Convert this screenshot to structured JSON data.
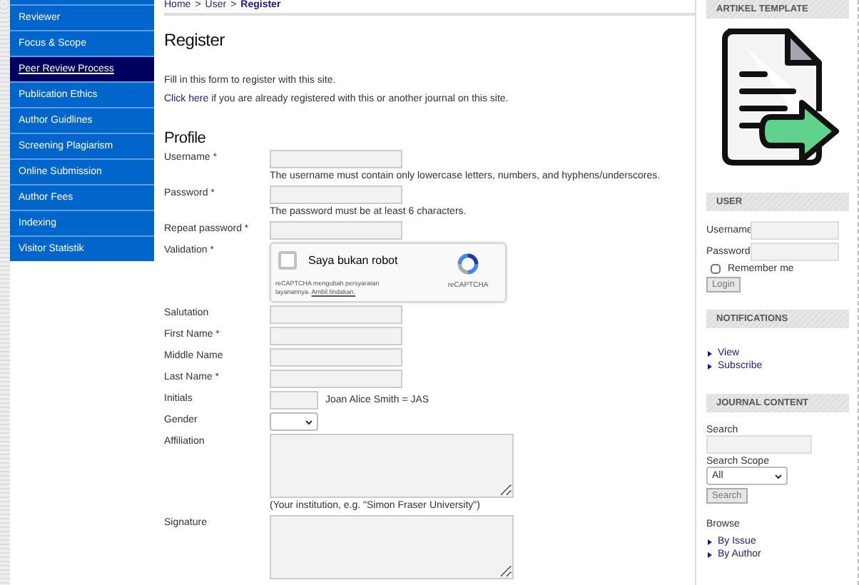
{
  "breadcrumb": {
    "items": [
      {
        "label": "Home",
        "selected": false
      },
      {
        "label": "User",
        "selected": false
      },
      {
        "label": "Register",
        "selected": true
      }
    ],
    "separator": ">"
  },
  "nav": {
    "items": [
      {
        "label": "Reviewer",
        "selected": false
      },
      {
        "label": "Focus & Scope",
        "selected": false
      },
      {
        "label": "Peer Review Process",
        "selected": true
      },
      {
        "label": "Publication Ethics",
        "selected": false
      },
      {
        "label": "Author Guidlines",
        "selected": false
      },
      {
        "label": "Screening Plagiarism",
        "selected": false
      },
      {
        "label": "Online Submission",
        "selected": false
      },
      {
        "label": "Author Fees",
        "selected": false
      },
      {
        "label": "Indexing",
        "selected": false
      },
      {
        "label": "Visitor Statistik",
        "selected": false
      }
    ]
  },
  "main": {
    "title": "Register",
    "intro": "Fill in this form to register with this site.",
    "login_link": "Click here",
    "login_text": "if you are already registered with this or another journal on this site.",
    "section_title": "Profile",
    "fields": [
      {
        "kind": "text",
        "label": "Username *",
        "hint": "The username must contain only lowercase letters, numbers, and hyphens/underscores."
      },
      {
        "kind": "password",
        "label": "Password *",
        "hint": "The password must be at least 6 characters."
      },
      {
        "kind": "password",
        "label": "Repeat password *"
      },
      {
        "kind": "captcha",
        "label": "Validation *",
        "checkbox_label": "Saya bukan robot",
        "checked": false,
        "brand": "reCAPTCHA",
        "notice": "reCAPTCHA mengubah persyaratan layanannya.",
        "notice_link": "Ambil tindakan."
      },
      {
        "kind": "text",
        "label": "Salutation"
      },
      {
        "kind": "text",
        "label": "First Name *"
      },
      {
        "kind": "text",
        "label": "Middle Name"
      },
      {
        "kind": "text",
        "label": "Last Name *"
      },
      {
        "kind": "short",
        "label": "Initials",
        "note": "Joan Alice Smith = JAS"
      },
      {
        "kind": "select",
        "label": "Gender"
      },
      {
        "kind": "textarea",
        "label": "Affiliation",
        "hint": "(Your institution, e.g. \"Simon Fraser University\")"
      },
      {
        "kind": "textarea",
        "label": "Signature"
      }
    ]
  },
  "sidebar": {
    "blocks": [
      {
        "kind": "image",
        "title": "ARTIKEL TEMPLATE"
      },
      {
        "kind": "login",
        "title": "USER",
        "username_label": "Username",
        "password_label": "Password",
        "remember_label": "Remember me",
        "remember_checked": false,
        "button": "Login"
      },
      {
        "kind": "links",
        "title": "NOTIFICATIONS",
        "links": [
          "View",
          "Subscribe"
        ]
      },
      {
        "kind": "search",
        "title": "JOURNAL CONTENT",
        "search_label": "Search",
        "scope_label": "Search Scope",
        "scope_value": "All",
        "button": "Search",
        "browse_label": "Browse",
        "links": [
          "By Issue",
          "By Author"
        ]
      }
    ]
  }
}
